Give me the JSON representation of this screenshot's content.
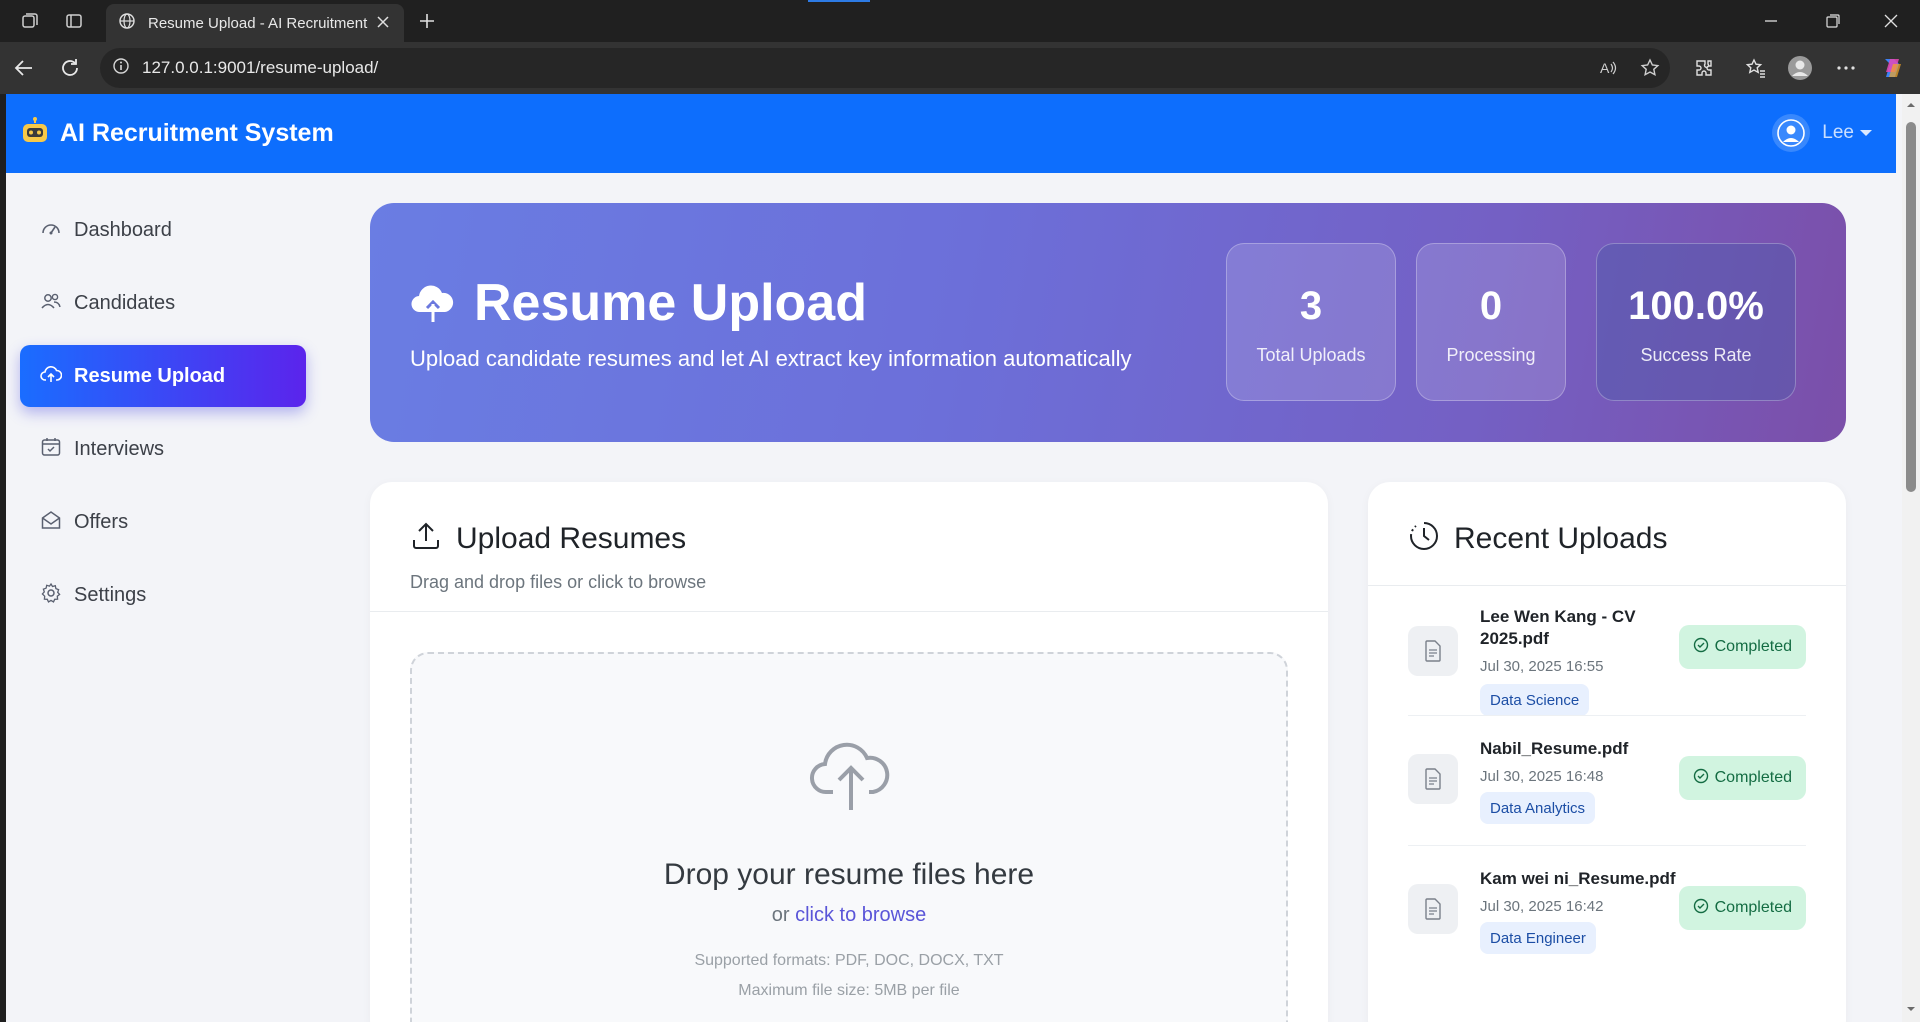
{
  "browser": {
    "tab_title": "Resume Upload - AI Recruitment System",
    "url": "127.0.0.1:9001/resume-upload/"
  },
  "header": {
    "brand": "AI Recruitment System",
    "user_name": "Lee"
  },
  "sidebar": {
    "items": [
      {
        "label": "Dashboard",
        "icon": "speedometer-icon",
        "active": false
      },
      {
        "label": "Candidates",
        "icon": "people-icon",
        "active": false
      },
      {
        "label": "Resume Upload",
        "icon": "cloud-upload-icon",
        "active": true
      },
      {
        "label": "Interviews",
        "icon": "calendar-icon",
        "active": false
      },
      {
        "label": "Offers",
        "icon": "envelope-icon",
        "active": false
      },
      {
        "label": "Settings",
        "icon": "gear-icon",
        "active": false
      }
    ]
  },
  "hero": {
    "title": "Resume Upload",
    "subtitle": "Upload candidate resumes and let AI extract key information automatically",
    "stats": [
      {
        "value": "3",
        "label": "Total Uploads"
      },
      {
        "value": "0",
        "label": "Processing"
      },
      {
        "value": "100.0%",
        "label": "Success Rate"
      }
    ]
  },
  "upload": {
    "title": "Upload Resumes",
    "subtitle": "Drag and drop files or click to browse",
    "drop_title": "Drop your resume files here",
    "or_text": "or",
    "browse_text": "click to browse",
    "formats": "Supported formats: PDF, DOC, DOCX, TXT",
    "max_size": "Maximum file size: 5MB per file"
  },
  "recent": {
    "title": "Recent Uploads",
    "items": [
      {
        "name": "Lee Wen Kang - CV 2025.pdf",
        "date": "Jul 30, 2025 16:55",
        "tag": "Data Science",
        "status": "Completed"
      },
      {
        "name": "Nabil_Resume.pdf",
        "date": "Jul 30, 2025 16:48",
        "tag": "Data Analytics",
        "status": "Completed"
      },
      {
        "name": "Kam wei ni_Resume.pdf",
        "date": "Jul 30, 2025 16:42",
        "tag": "Data Engineer",
        "status": "Completed"
      }
    ]
  },
  "colors": {
    "primary": "#0d6efd",
    "sidebar_active_start": "#1a6dff",
    "sidebar_active_end": "#5b24ec",
    "hero_start": "#6a7de3",
    "hero_end": "#7b4fa9",
    "success_bg": "#d1f4e0",
    "success_text": "#146c43",
    "tag_bg": "#e8f0fe"
  }
}
